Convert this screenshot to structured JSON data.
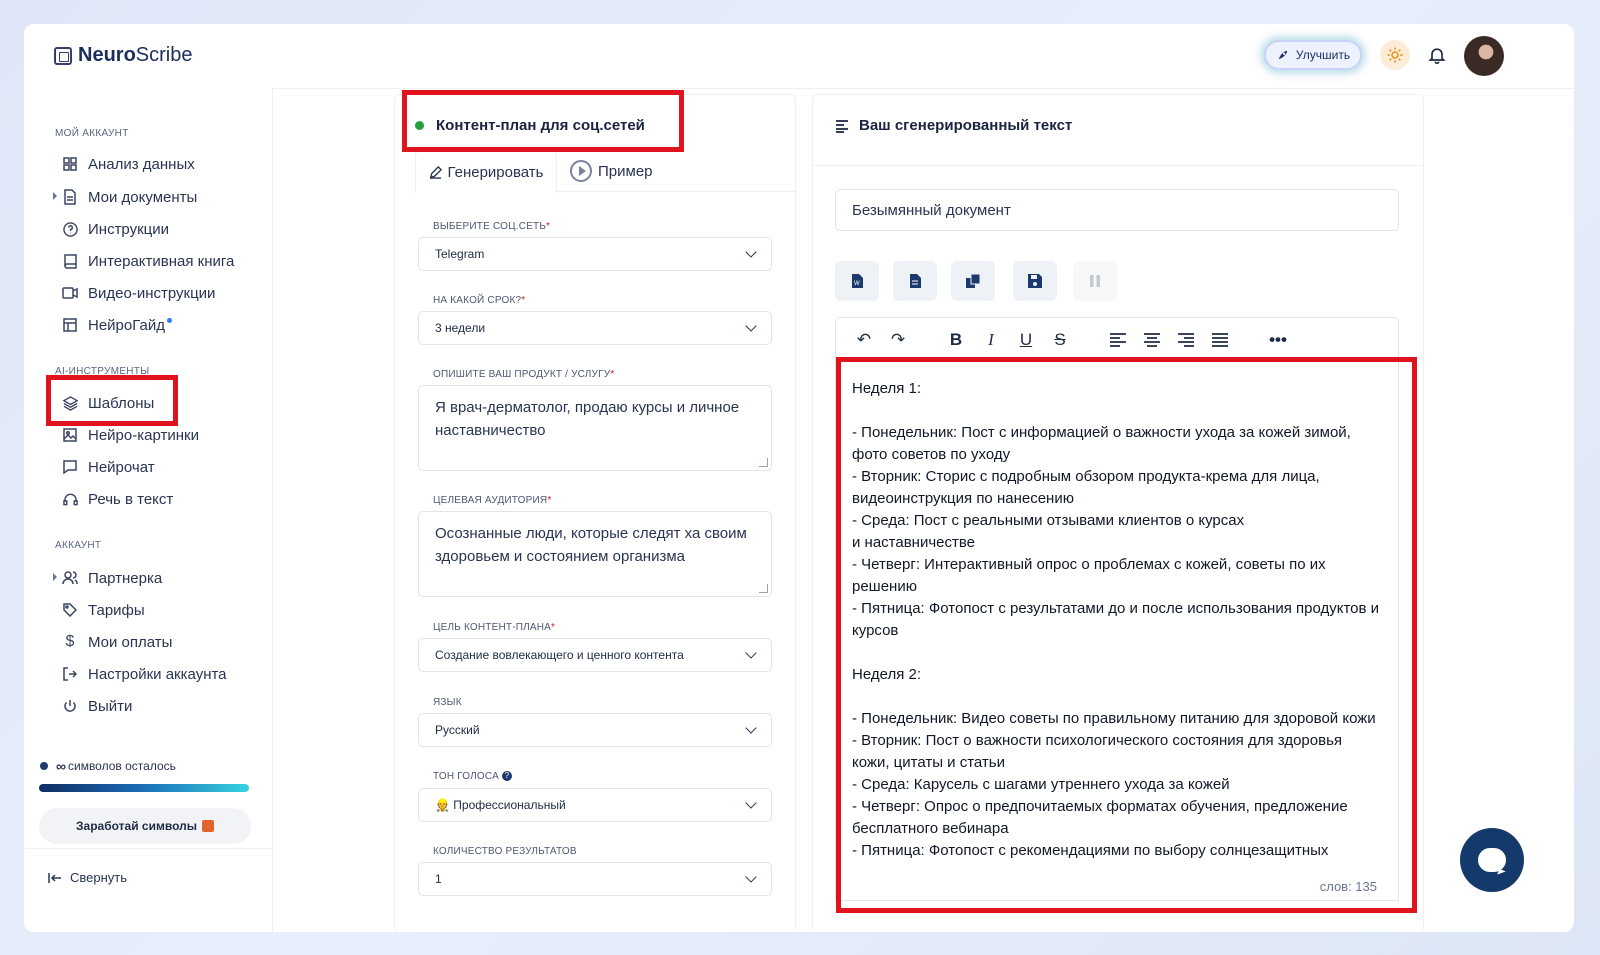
{
  "app": {
    "logo_bold": "Neuro",
    "logo_light": "Scribe"
  },
  "header": {
    "upgrade_label": "Улучшить"
  },
  "sidebar": {
    "sections": [
      {
        "title": "МОЙ АККАУНТ"
      },
      {
        "title": "AI-ИНСТРУМЕНТЫ"
      },
      {
        "title": "АККАУНТ"
      }
    ],
    "account_items": [
      {
        "label": "Анализ данных",
        "icon": "grid-icon"
      },
      {
        "label": "Мои документы",
        "icon": "document-icon"
      },
      {
        "label": "Инструкции",
        "icon": "help-circle-icon"
      },
      {
        "label": "Интерактивная книга",
        "icon": "book-icon"
      },
      {
        "label": "Видео-инструкции",
        "icon": "video-icon"
      },
      {
        "label": "НейроГайд",
        "icon": "layout-icon"
      }
    ],
    "ai_items": [
      {
        "label": "Шаблоны",
        "icon": "layers-icon"
      },
      {
        "label": "Нейро-картинки",
        "icon": "image-icon"
      },
      {
        "label": "Нейрочат",
        "icon": "chat-icon"
      },
      {
        "label": "Речь в текст",
        "icon": "headphones-icon"
      }
    ],
    "settings_items": [
      {
        "label": "Партнерка",
        "icon": "users-icon"
      },
      {
        "label": "Тарифы",
        "icon": "tag-icon"
      },
      {
        "label": "Мои оплаты",
        "icon": "dollar-icon"
      },
      {
        "label": "Настройки аккаунта",
        "icon": "logout-arrow-icon"
      },
      {
        "label": "Выйти",
        "icon": "power-icon"
      }
    ],
    "credits_symbol": "∞",
    "credits_text": "символов осталось",
    "earn_label": "Заработай символы",
    "collapse_label": "Свернуть"
  },
  "form": {
    "title": "Контент-план для соц.сетей",
    "tabs": {
      "generate": "Генерировать",
      "example": "Пример"
    },
    "social_label": "ВЫБЕРИТЕ СОЦ.СЕТЬ",
    "social_value": "Telegram",
    "period_label": "НА КАКОЙ СРОК?",
    "period_value": "3 недели",
    "product_label": "ОПИШИТЕ ВАШ ПРОДУКТ / УСЛУГУ",
    "product_value": "Я врач-дерматолог, продаю курсы и личное наставничество",
    "audience_label": "ЦЕЛЕВАЯ АУДИТОРИЯ",
    "audience_value": "Осознанные люди, которые следят ха своим здоровьем и состоянием организма",
    "goal_label": "ЦЕЛЬ КОНТЕНТ-ПЛАНА",
    "goal_value": "Создание вовлекающего и ценного контента",
    "lang_label": "ЯЗЫК",
    "lang_value": "Русский",
    "tone_label": "ТОН ГОЛОСА",
    "tone_value": "👷 Профессиональный",
    "count_label": "КОЛИЧЕСТВО РЕЗУЛЬТАТОВ",
    "count_value": "1",
    "required_mark": "*"
  },
  "output": {
    "title": "Ваш сгенерированный текст",
    "doc_name": "Безымянный документ",
    "word_count": "слов: 135",
    "text": [
      "Неделя 1:",
      "",
      "- Понедельник: Пост с информацией о важности ухода за кожей зимой, фото советов по уходу",
      "- Вторник: Сторис с подробным обзором продукта-крема для лица, видеоинструкция по нанесению",
      "- Среда: Пост с реальными отзывами клиентов о курсах\nи наставничестве",
      "- Четверг: Интерактивный опрос о проблемах с кожей, советы по их решению",
      "- Пятница: Фотопост с результатами до и после использования продуктов и курсов",
      "",
      "Неделя 2:",
      "",
      "- Понедельник: Видео советы по правильному питанию для здоровой кожи",
      "- Вторник: Пост о важности психологического состояния для здоровья кожи, цитаты и статьи",
      "- Среда: Карусель с шагами утреннего ухода за кожей",
      "- Четверг: Опрос о предпочитаемых форматах обучения, предложение бесплатного вебинара",
      "- Пятница: Фотопост с рекомендациями по выбору солнцезащитных"
    ]
  },
  "colors": {
    "accent": "#1d3a6e",
    "highlight": "#e0141e",
    "status_green": "#26a142"
  }
}
